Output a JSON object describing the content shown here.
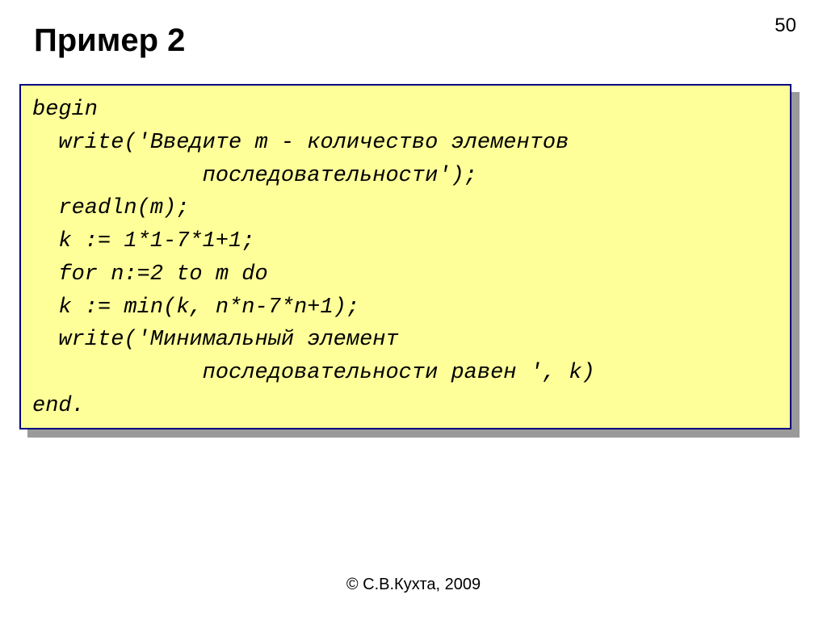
{
  "slide": {
    "page_number": "50",
    "title": "Пример 2",
    "footer": "© С.В.Кухта, 2009"
  },
  "code": {
    "lines": "begin\n  write('Введите m - количество элементов \n             последовательности');\n  readln(m);\n  k := 1*1-7*1+1;  \n  for n:=2 to m do\n  k := min(k, n*n-7*n+1);\n  write('Минимальный элемент \n             последовательности равен ', k)\nend."
  }
}
